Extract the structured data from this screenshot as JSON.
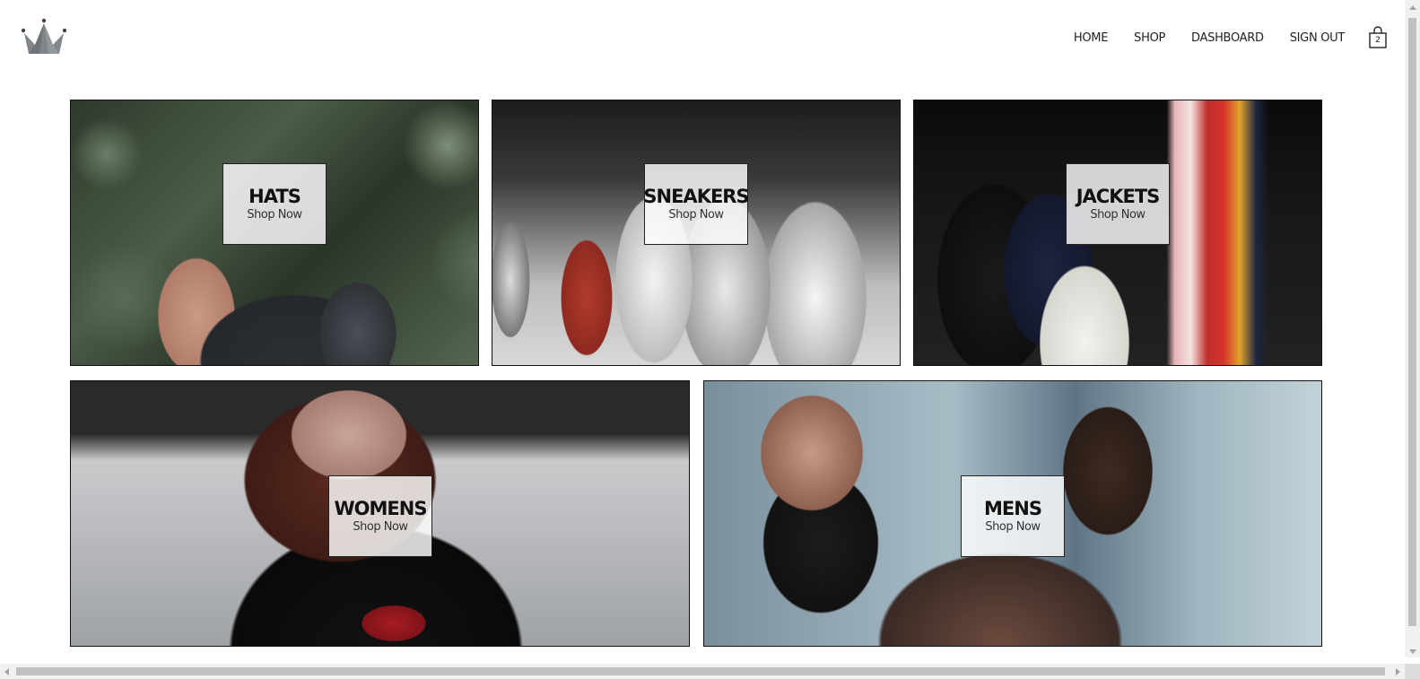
{
  "header": {
    "logo_icon": "crown-icon",
    "nav": [
      {
        "label": "HOME"
      },
      {
        "label": "SHOP"
      },
      {
        "label": "DASHBOARD"
      },
      {
        "label": "SIGN OUT"
      }
    ],
    "cart": {
      "icon": "shopping-bag-icon",
      "count": "2"
    }
  },
  "directory": [
    {
      "title": "HATS",
      "subtitle": "Shop Now"
    },
    {
      "title": "SNEAKERS",
      "subtitle": "Shop Now"
    },
    {
      "title": "JACKETS",
      "subtitle": "Shop Now"
    },
    {
      "title": "WOMENS",
      "subtitle": "Shop Now"
    },
    {
      "title": "MENS",
      "subtitle": "Shop Now"
    }
  ]
}
